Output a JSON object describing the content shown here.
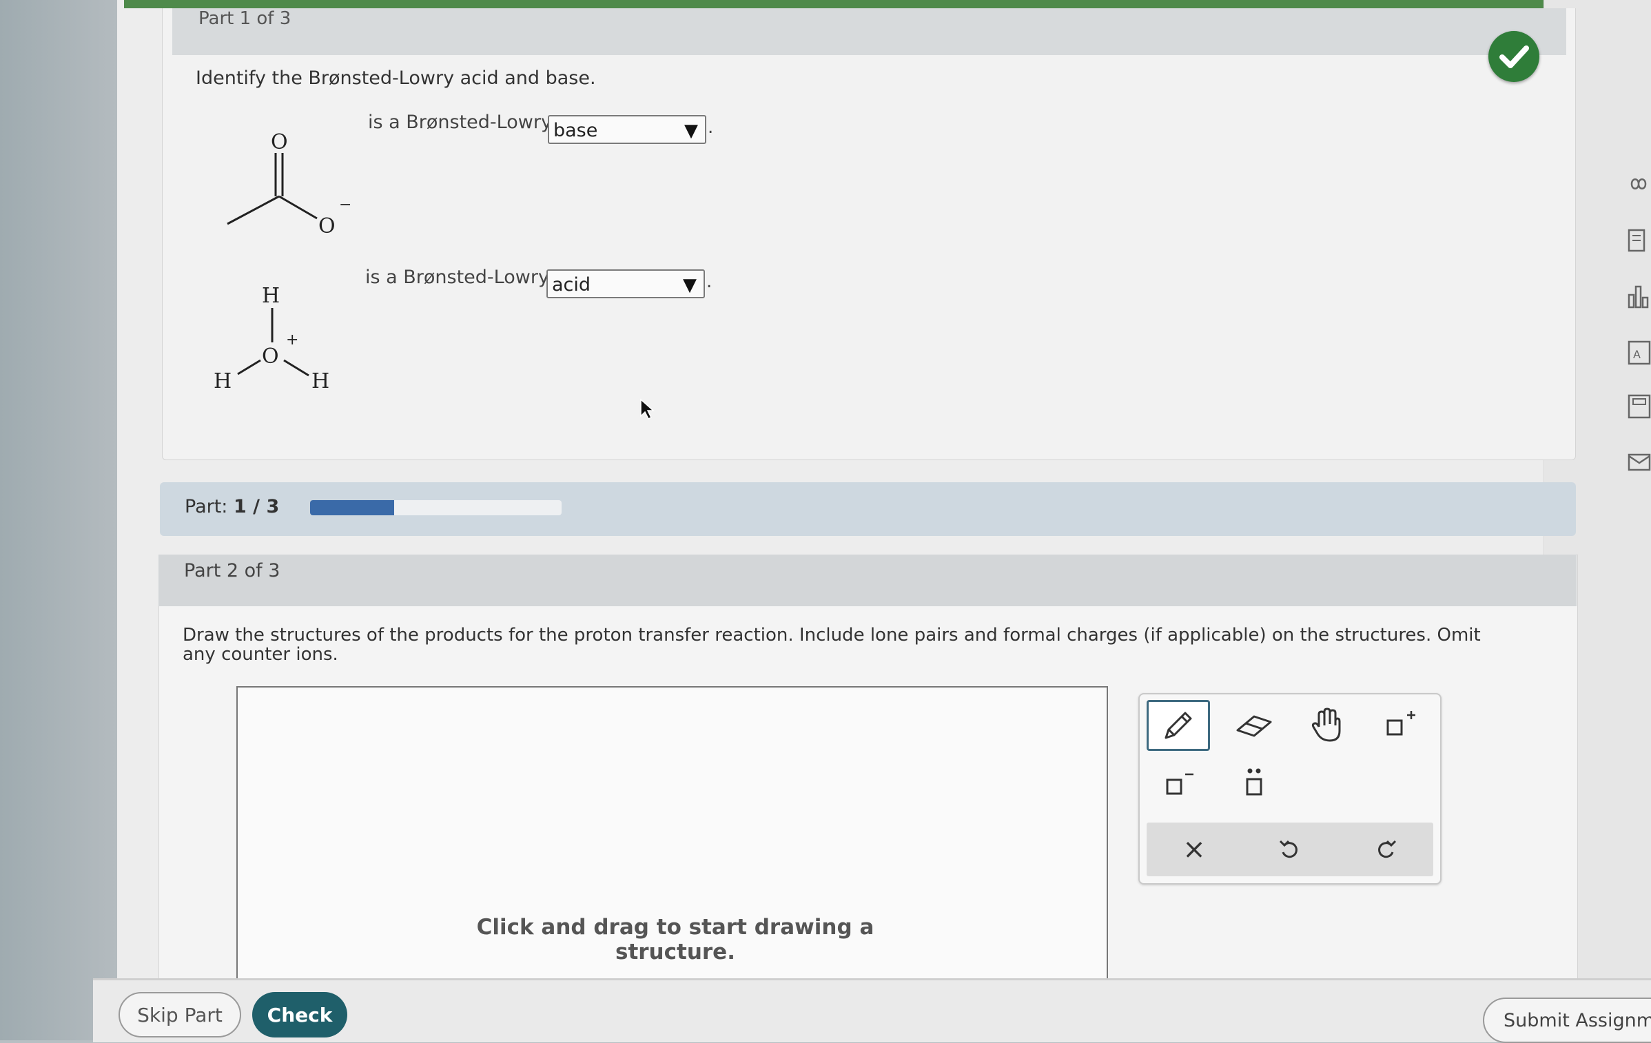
{
  "part1": {
    "title": "Part 1 of 3",
    "question": "Identify the Brønsted-Lowry acid and base.",
    "rows": [
      {
        "label": "is a Brønsted-Lowry",
        "selected": "base"
      },
      {
        "label": "is a Brønsted-Lowry",
        "selected": "acid"
      }
    ],
    "molecule1": {
      "atom_o_top": "O",
      "atom_o_bottom": "O",
      "charge": "−"
    },
    "molecule2": {
      "atom_h_top": "H",
      "atom_o": "O",
      "atom_h_left": "H",
      "atom_h_right": "H",
      "charge": "+"
    },
    "period": "."
  },
  "progress": {
    "label_prefix": "Part:",
    "label_value": "1 / 3",
    "fraction": 0.333
  },
  "part2": {
    "title": "Part 2 of 3",
    "question": "Draw the structures of the products for the proton transfer reaction. Include lone pairs and formal charges (if applicable) on the structures. Omit any counter ions.",
    "canvas_hint": "Click and drag to start drawing a structure.",
    "toolbar": {
      "tools": [
        "pencil-icon",
        "eraser-icon",
        "hand-icon",
        "positive-charge-icon",
        "negative-charge-icon",
        "lone-pair-icon"
      ],
      "actions": [
        "clear-icon",
        "undo-icon",
        "redo-icon"
      ],
      "clear_glyph": "×"
    }
  },
  "footer": {
    "skip_label": "Skip Part",
    "check_label": "Check",
    "submit_label": "Submit Assignme"
  },
  "colors": {
    "accent": "#1f5f6a",
    "success": "#2f7d39",
    "progress": "#3a6aa8"
  }
}
